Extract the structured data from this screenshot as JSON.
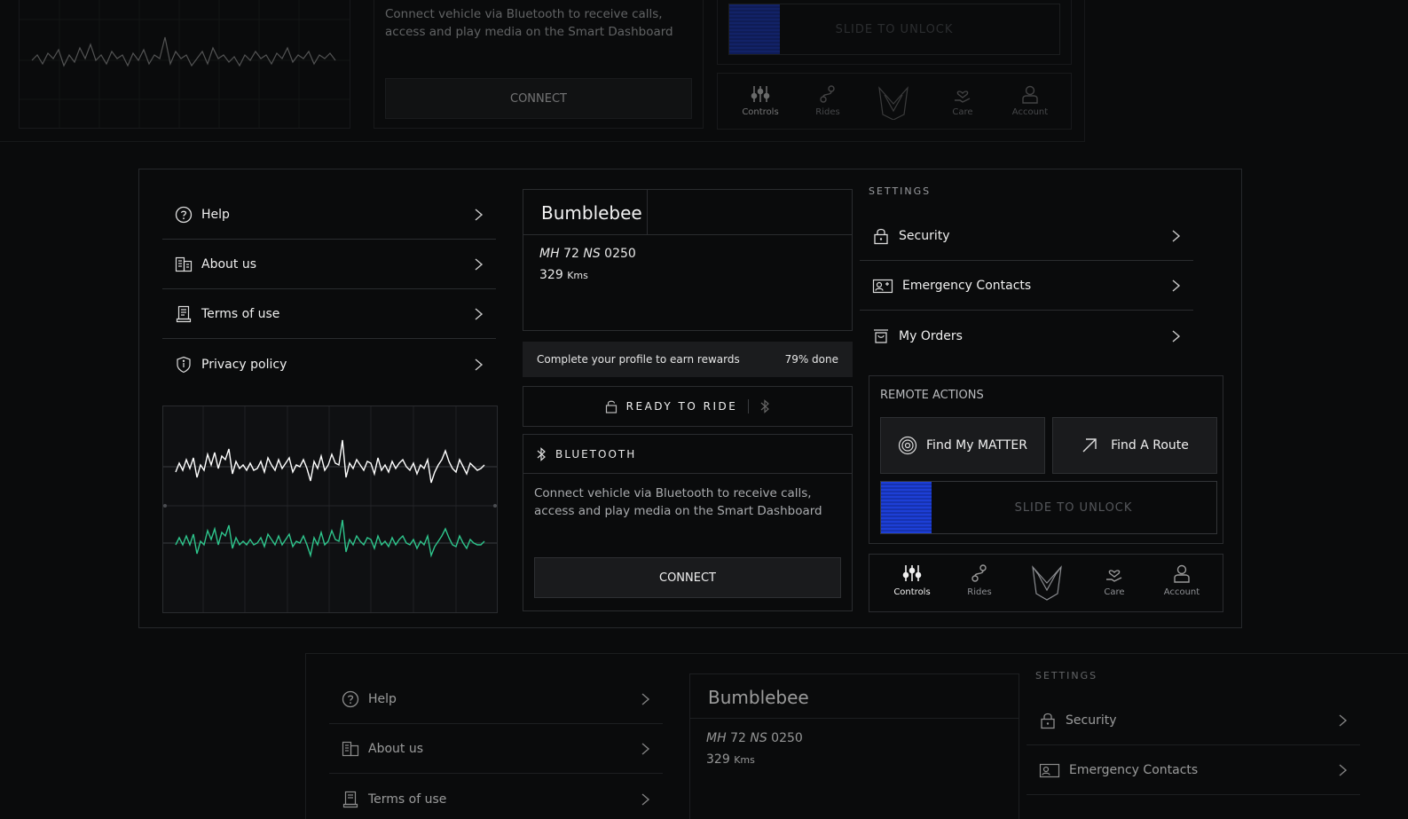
{
  "menu": {
    "help": "Help",
    "about": "About us",
    "terms": "Terms of use",
    "privacy": "Privacy policy"
  },
  "vehicle": {
    "name": "Bumblebee",
    "plate_prefix": "MH",
    "plate_num1": "72",
    "plate_mid": "NS",
    "plate_num2": "0250",
    "range_value": "329",
    "range_unit": "Kms"
  },
  "profile": {
    "message": "Complete your profile to earn rewards",
    "progress_text": "79% done",
    "progress": 0.79
  },
  "ride_status": "READY TO RIDE",
  "bluetooth": {
    "title": "BLUETOOTH",
    "description": "Connect vehicle via Bluetooth to receive calls, access and play media on the Smart Dashboard",
    "connect_label": "CONNECT"
  },
  "settings": {
    "title": "SETTINGS",
    "security": "Security",
    "emergency": "Emergency Contacts",
    "orders": "My Orders"
  },
  "remote": {
    "title": "REMOTE ACTIONS",
    "find_matter": "Find My MATTER",
    "find_route": "Find A Route",
    "slide_unlock": "SLIDE TO UNLOCK"
  },
  "nav": {
    "controls": "Controls",
    "rides": "Rides",
    "care": "Care",
    "account": "Account"
  },
  "colors": {
    "slider_blue": "#1d3fd6",
    "chart_white": "#ffffff",
    "chart_green": "#2ec58c"
  }
}
